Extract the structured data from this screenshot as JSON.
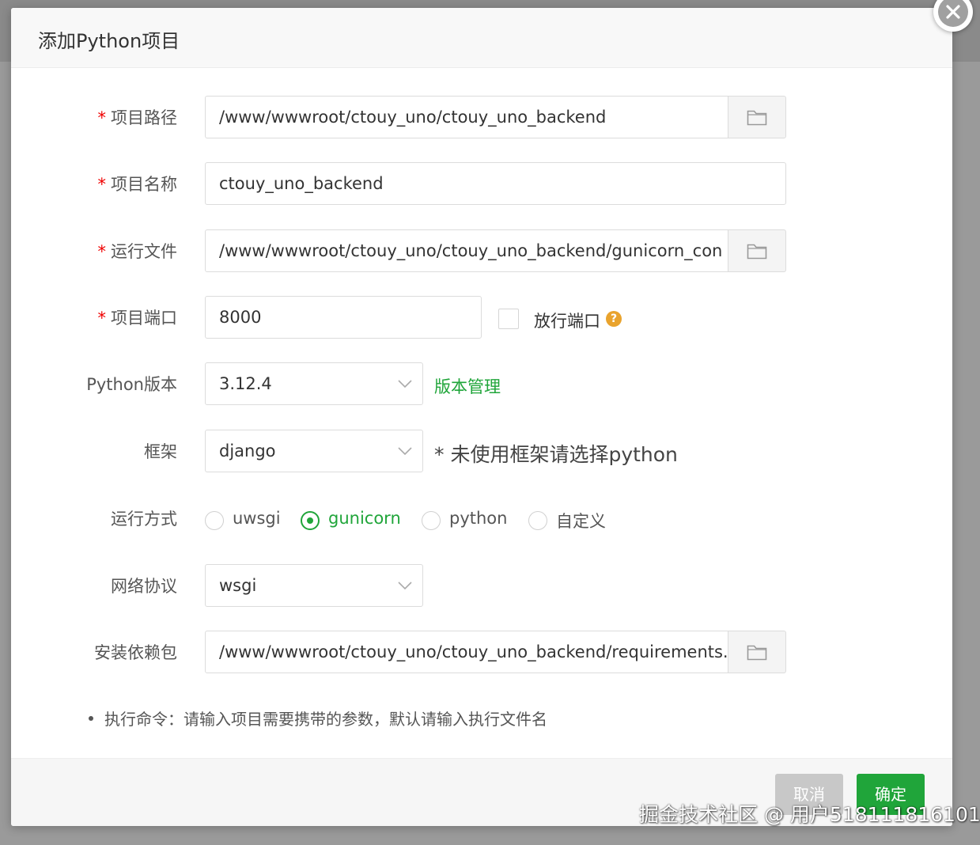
{
  "dialog": {
    "title": "添加Python项目"
  },
  "form": {
    "project_path": {
      "label": "项目路径",
      "required_mark": "*",
      "value": "/www/wwwroot/ctouy_uno/ctouy_uno_backend"
    },
    "project_name": {
      "label": "项目名称",
      "required_mark": "*",
      "value": "ctouy_uno_backend"
    },
    "run_file": {
      "label": "运行文件",
      "required_mark": "*",
      "value": "/www/wwwroot/ctouy_uno/ctouy_uno_backend/gunicorn_con"
    },
    "project_port": {
      "label": "项目端口",
      "required_mark": "*",
      "value": "8000",
      "open_port_label": "放行端口",
      "open_port_checked": false,
      "help_icon": "?"
    },
    "python_version": {
      "label": "Python版本",
      "value": "3.12.4",
      "manage_link": "版本管理"
    },
    "framework": {
      "label": "框架",
      "value": "django",
      "hint": "* 未使用框架请选择python"
    },
    "run_mode": {
      "label": "运行方式",
      "options": [
        "uwsgi",
        "gunicorn",
        "python",
        "自定义"
      ],
      "selected": "gunicorn"
    },
    "network_protocol": {
      "label": "网络协议",
      "value": "wsgi"
    },
    "requirements": {
      "label": "安装依赖包",
      "value": "/www/wwwroot/ctouy_uno/ctouy_uno_backend/requirements."
    },
    "tip": "执行命令：请输入项目需要携带的参数，默认请输入执行文件名"
  },
  "footer": {
    "cancel_label": "取消",
    "ok_label": "确定"
  },
  "watermark": "掘金技术社区 @ 用户518111816101",
  "colors": {
    "accent": "#20a53a",
    "required": "#ef0000",
    "help": "#e9a32d"
  }
}
